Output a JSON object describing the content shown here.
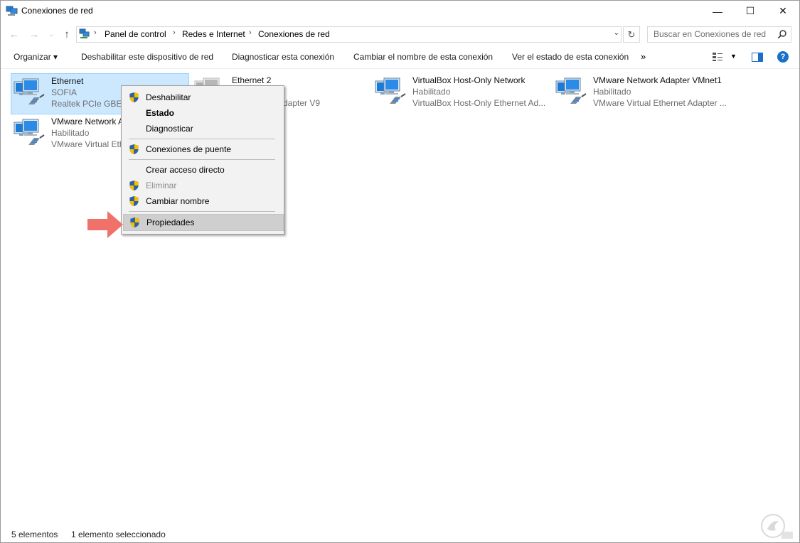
{
  "window": {
    "title": "Conexiones de red",
    "min_glyph": "—",
    "max_glyph": "☐",
    "close_glyph": "✕"
  },
  "address": {
    "crumbs": [
      "Panel de control",
      "Redes e Internet",
      "Conexiones de red"
    ],
    "search_placeholder": "Buscar en Conexiones de red"
  },
  "toolbar": {
    "organize": "Organizar ▾",
    "disable": "Deshabilitar este dispositivo de red",
    "diagnose": "Diagnosticar esta conexión",
    "rename": "Cambiar el nombre de esta conexión",
    "status": "Ver el estado de esta conexión",
    "more": "»",
    "help": "?"
  },
  "items": [
    {
      "name": "Ethernet",
      "status": "SOFIA",
      "device": "Realtek PCIe GBE F",
      "selected": true
    },
    {
      "name": "Ethernet 2",
      "status": "",
      "device": "dapter V9",
      "selected": false
    },
    {
      "name": "VirtualBox Host-Only Network",
      "status": "Habilitado",
      "device": "VirtualBox Host-Only Ethernet Ad...",
      "selected": false
    },
    {
      "name": "VMware Network Adapter VMnet1",
      "status": "Habilitado",
      "device": "VMware Virtual Ethernet Adapter ...",
      "selected": false
    },
    {
      "name": "VMware Network A",
      "status": "Habilitado",
      "device": "VMware Virtual Eth",
      "selected": false
    }
  ],
  "context_menu": {
    "items": [
      {
        "label": "Deshabilitar"
      },
      {
        "label": "Estado"
      },
      {
        "label": "Diagnosticar"
      },
      {
        "label": "Conexiones de puente"
      },
      {
        "label": "Crear acceso directo"
      },
      {
        "label": "Eliminar"
      },
      {
        "label": "Cambiar nombre"
      },
      {
        "label": "Propiedades"
      }
    ]
  },
  "statusbar": {
    "count": "5 elementos",
    "selected": "1 elemento seleccionado"
  },
  "colors": {
    "selection": "#cce8ff",
    "accent": "#1a6fc9",
    "arrow": "#f0706a"
  }
}
